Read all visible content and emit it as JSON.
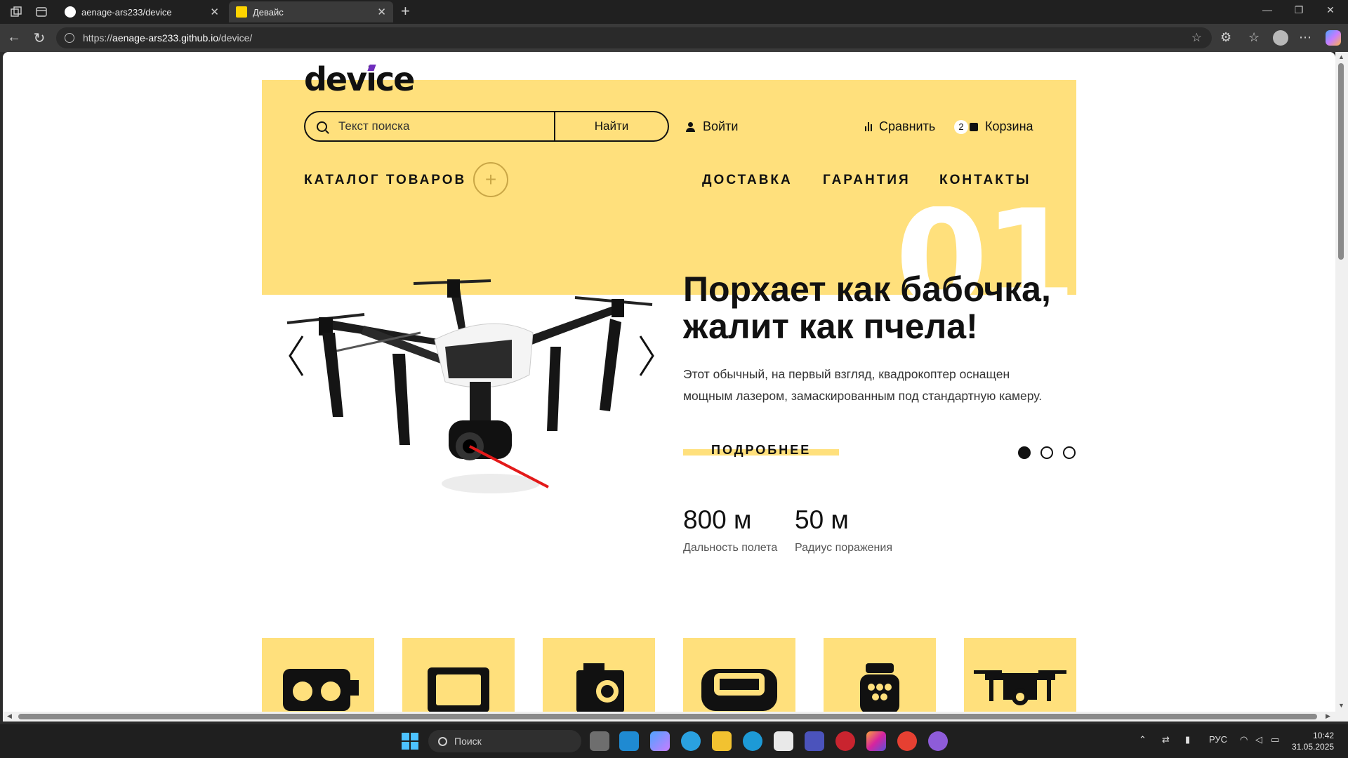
{
  "browser": {
    "tabs": [
      {
        "title": "aenage-ars233/device",
        "active": false
      },
      {
        "title": "Девайс",
        "active": true
      }
    ],
    "url_prefix": "https://",
    "url_domain": "aenage-ars233.github.io",
    "url_path": "/device/"
  },
  "header": {
    "logo": "device",
    "search": {
      "placeholder": "Текст поиска",
      "button": "Найти"
    },
    "login": "Войти",
    "compare": "Сравнить",
    "cart": {
      "count": "2",
      "label": "Корзина"
    },
    "catalog": "КАТАЛОГ ТОВАРОВ",
    "menu": [
      "ДОСТАВКА",
      "ГАРАНТИЯ",
      "КОНТАКТЫ"
    ]
  },
  "slide": {
    "number": "01",
    "headline_line1": "Порхает как бабочка,",
    "headline_line2": "жалит как пчела!",
    "desc_line1": "Этот обычный, на первый взгляд, квадрокоптер оснащен",
    "desc_line2": "мощным лазером, замаскированным под стандартную камеру.",
    "more": "ПОДРОБНЕЕ",
    "dots_active": 0,
    "stats": [
      {
        "value": "800 м",
        "label": "Дальность полета"
      },
      {
        "value": "50 м",
        "label": "Радиус поражения"
      }
    ]
  },
  "categories": [
    "vr-icon",
    "tablet-icon",
    "action-camera-icon",
    "fitness-band-icon",
    "smart-speaker-icon",
    "drone-icon"
  ],
  "colors": {
    "accent": "#ffe07c",
    "text": "#111111",
    "laser": "#e31919"
  },
  "taskbar": {
    "search": "Поиск",
    "lang": "РУС",
    "time": "10:42",
    "date": "31.05.2025"
  }
}
